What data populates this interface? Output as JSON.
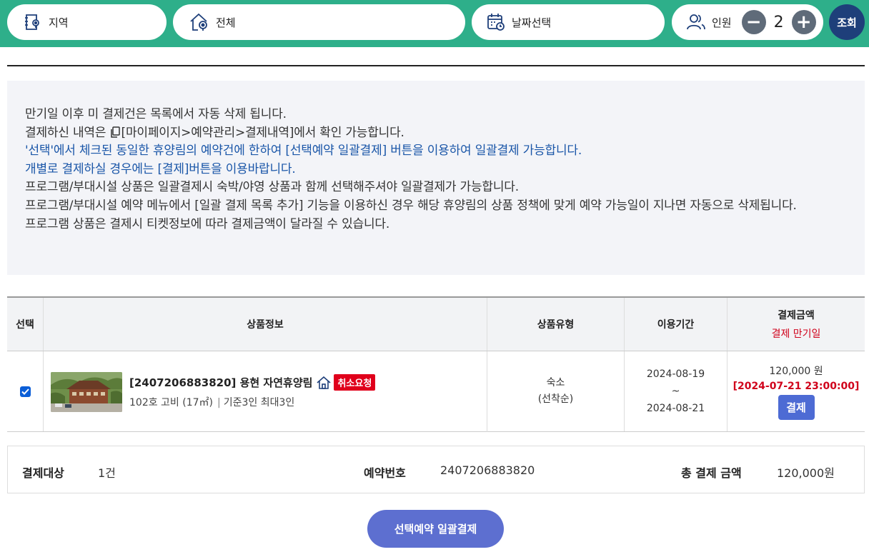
{
  "search": {
    "region_label": "지역",
    "area_label": "전체",
    "date_label": "날짜선택",
    "people_label": "인원",
    "people_count": "2",
    "minus": "−",
    "plus": "+",
    "search_button": "조회"
  },
  "notice": {
    "lines": [
      "만기일 이후 미 결제건은 목록에서 자동 삭제 됩니다.",
      "결제하신 내역은",
      "[마이페이지>예약관리>결제내역]에서 확인 가능합니다.",
      "'선택'에서 체크된 동일한 휴양림의 예약건에 한하여 [선택예약 일괄결제] 버튼을 이용하여 일괄결제 가능합니다.",
      "개별로 결제하실 경우에는 [결제]버튼을 이용바랍니다.",
      "프로그램/부대시설 상품은 일괄결제시 숙박/야영 상품과 함께 선택해주셔야 일괄결제가 가능합니다.",
      "프로그램/부대시설 예약 메뉴에서 [일괄 결제 목록 추가] 기능을 이용하신 경우 해당 휴양림의 상품 정책에 맞게 예약 가능일이 지나면 자동으로 삭제됩니다.",
      "프로그램 상품은 결제시 티켓정보에 따라 결제금액이 달라질 수 있습니다."
    ]
  },
  "table": {
    "headers": {
      "select": "선택",
      "product": "상품정보",
      "type": "상품유형",
      "period": "이용기간",
      "amount": "결제금액",
      "amount_sub": "결제 만기일"
    },
    "row": {
      "checked": true,
      "title": "[2407206883820] 용현 자연휴양림",
      "badge": "취소요청",
      "room": "102호 고비 (17㎡)",
      "capacity": "기준3인 최대3인",
      "type_line1": "숙소",
      "type_line2": "(선착순)",
      "date_start": "2024-08-19",
      "date_sep": "~",
      "date_end": "2024-08-21",
      "price": "120,000 원",
      "deadline": "[2024-07-21 23:00:00]",
      "pay_button": "결제"
    }
  },
  "summary": {
    "target_label": "결제대상",
    "target_value": "1건",
    "reservation_label": "예약번호",
    "reservation_value": "2407206883820",
    "total_label": "총 결제 금액",
    "total_value": "120,000원"
  },
  "batch_button": "선택예약 일괄결제",
  "colors": {
    "header_bg": "#2eaf8a",
    "search_button": "#1e3f7a",
    "deadline_red": "#d0021b",
    "badge_red": "#e0001b",
    "pay_button": "#4d6bd4",
    "batch_button": "#5d6fd0",
    "notice_blue": "#1a56a8"
  },
  "icons": {
    "region": "map-book-icon",
    "area": "home-pin-icon",
    "date": "calendar-clock-icon",
    "people": "users-icon",
    "copy": "copy-icon",
    "lodge": "house-icon"
  }
}
